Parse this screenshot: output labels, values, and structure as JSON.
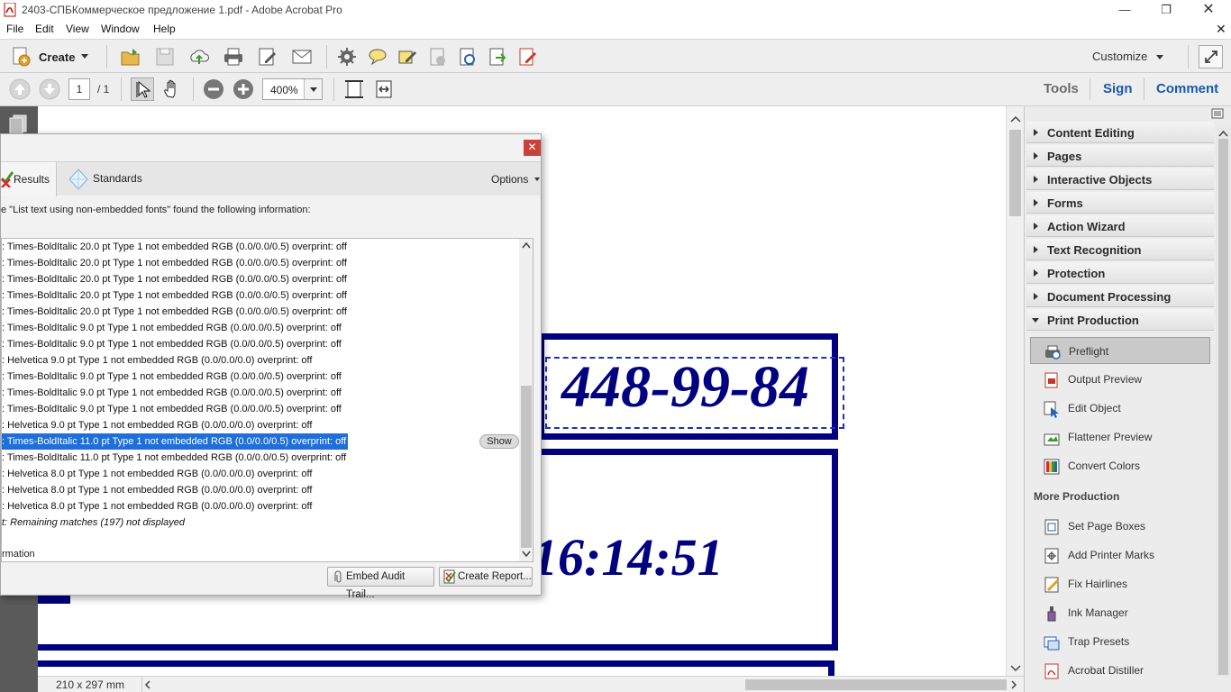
{
  "window": {
    "title": "2403-СПБКоммерческое предложение 1.pdf - Adobe Acrobat Pro"
  },
  "menu": [
    "File",
    "Edit",
    "View",
    "Window",
    "Help"
  ],
  "toolbar": {
    "create_label": "Create",
    "customize_label": "Customize"
  },
  "nav": {
    "page_value": "1",
    "page_total": "/ 1",
    "zoom_value": "400%"
  },
  "panes": {
    "tools": "Tools",
    "sign": "Sign",
    "comment": "Comment"
  },
  "document": {
    "phone_text": "448-99-84",
    "time_text": "16:14:51",
    "page_size": "210 x 297 mm"
  },
  "dialog": {
    "tab_results": "Results",
    "tab_standards": "Standards",
    "options_label": "Options",
    "summary": "e \"List text using non-embedded fonts\" found the following information:",
    "rows": [
      ": Times-BoldItalic 20.0 pt Type 1 not embedded RGB (0.0/0.0/0.5)  overprint: off",
      ": Times-BoldItalic 20.0 pt Type 1 not embedded RGB (0.0/0.0/0.5)  overprint: off",
      ": Times-BoldItalic 20.0 pt Type 1 not embedded RGB (0.0/0.0/0.5)  overprint: off",
      ": Times-BoldItalic 20.0 pt Type 1 not embedded RGB (0.0/0.0/0.5)  overprint: off",
      ": Times-BoldItalic 20.0 pt Type 1 not embedded RGB (0.0/0.0/0.5)  overprint: off",
      ": Times-BoldItalic 9.0 pt Type 1 not embedded RGB (0.0/0.0/0.5)  overprint: off",
      ": Times-BoldItalic 9.0 pt Type 1 not embedded RGB (0.0/0.0/0.5)  overprint: off",
      ": Helvetica 9.0 pt Type 1 not embedded RGB (0.0/0.0/0.0)  overprint: off",
      ": Times-BoldItalic 9.0 pt Type 1 not embedded RGB (0.0/0.0/0.5)  overprint: off",
      ": Times-BoldItalic 9.0 pt Type 1 not embedded RGB (0.0/0.0/0.5)  overprint: off",
      ": Times-BoldItalic 9.0 pt Type 1 not embedded RGB (0.0/0.0/0.5)  overprint: off",
      ": Helvetica 9.0 pt Type 1 not embedded RGB (0.0/0.0/0.0)  overprint: off",
      ": Times-BoldItalic 11.0 pt Type 1 not embedded RGB (0.0/0.0/0.5)  overprint: off",
      ": Times-BoldItalic 11.0 pt Type 1 not embedded RGB (0.0/0.0/0.5)  overprint: off",
      ": Helvetica 8.0 pt Type 1 not embedded RGB (0.0/0.0/0.0)  overprint: off",
      ": Helvetica 8.0 pt Type 1 not embedded RGB (0.0/0.0/0.0)  overprint: off",
      ": Helvetica 8.0 pt Type 1 not embedded RGB (0.0/0.0/0.0)  overprint: off",
      "t: Remaining matches (197) not displayed"
    ],
    "selected_row": 12,
    "show_label": "Show",
    "info_label": "rmation",
    "embed_label": "Embed Audit Trail...",
    "report_label": "Create Report..."
  },
  "right_panel": {
    "sections": [
      "Content Editing",
      "Pages",
      "Interactive Objects",
      "Forms",
      "Action Wizard",
      "Text Recognition",
      "Protection",
      "Document Processing",
      "Print Production"
    ],
    "print_items": [
      "Preflight",
      "Output Preview",
      "Edit Object",
      "Flattener Preview",
      "Convert Colors"
    ],
    "more_heading": "More Production",
    "more_items": [
      "Set Page Boxes",
      "Add Printer Marks",
      "Fix Hairlines",
      "Ink Manager",
      "Trap Presets",
      "Acrobat Distiller"
    ]
  },
  "colors": {
    "doc_blue": "#000080",
    "selection_blue": "#1e6fd9",
    "pane_accent": "#1a5aa8"
  }
}
